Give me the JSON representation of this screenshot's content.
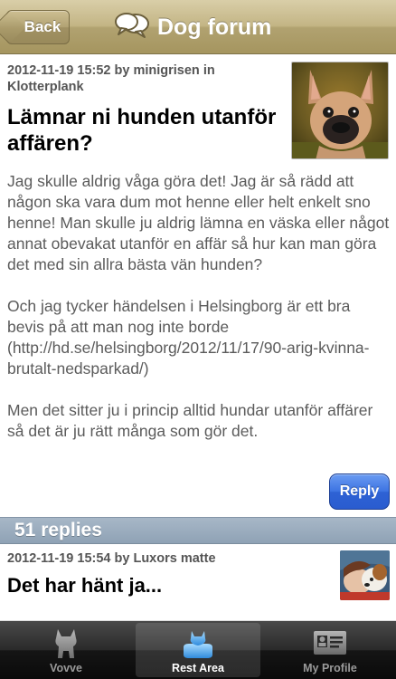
{
  "navbar": {
    "back_label": "Back",
    "title": "Dog forum",
    "background_color": "#b5a675"
  },
  "post": {
    "meta": "2012-11-19 15:52 by minigrisen in Klotterplank",
    "title": "Lämnar ni hunden utanför affären?",
    "paragraphs": [
      "Jag skulle aldrig våga göra det! Jag är så rädd att någon ska vara dum mot henne eller helt enkelt sno henne! Man skulle ju aldrig lämna en väska eller något annat obevakat utanför en affär så hur kan man göra det med sin allra bästa vän hunden?",
      "Och jag tycker händelsen i Helsingborg är ett bra bevis på att man nog inte borde (http://hd.se/helsingborg/2012/11/17/90-arig-kvinna-brutalt-nedsparkad/)",
      "Men det sitter ju i princip alltid hundar utanför affärer så det är ju rätt många som gör det."
    ],
    "reply_label": "Reply",
    "reply_color": "#3a6fe0"
  },
  "replies": {
    "header": "51 replies",
    "items": [
      {
        "meta": "2012-11-19 15:54 by Luxors matte",
        "title": "Det har hänt ja..."
      }
    ]
  },
  "tabbar": {
    "tabs": [
      {
        "label": "Vovve",
        "icon": "dog-silhouette-icon",
        "selected": false
      },
      {
        "label": "Rest Area",
        "icon": "dog-bed-icon",
        "selected": true
      },
      {
        "label": "My Profile",
        "icon": "id-card-icon",
        "selected": false
      }
    ]
  }
}
